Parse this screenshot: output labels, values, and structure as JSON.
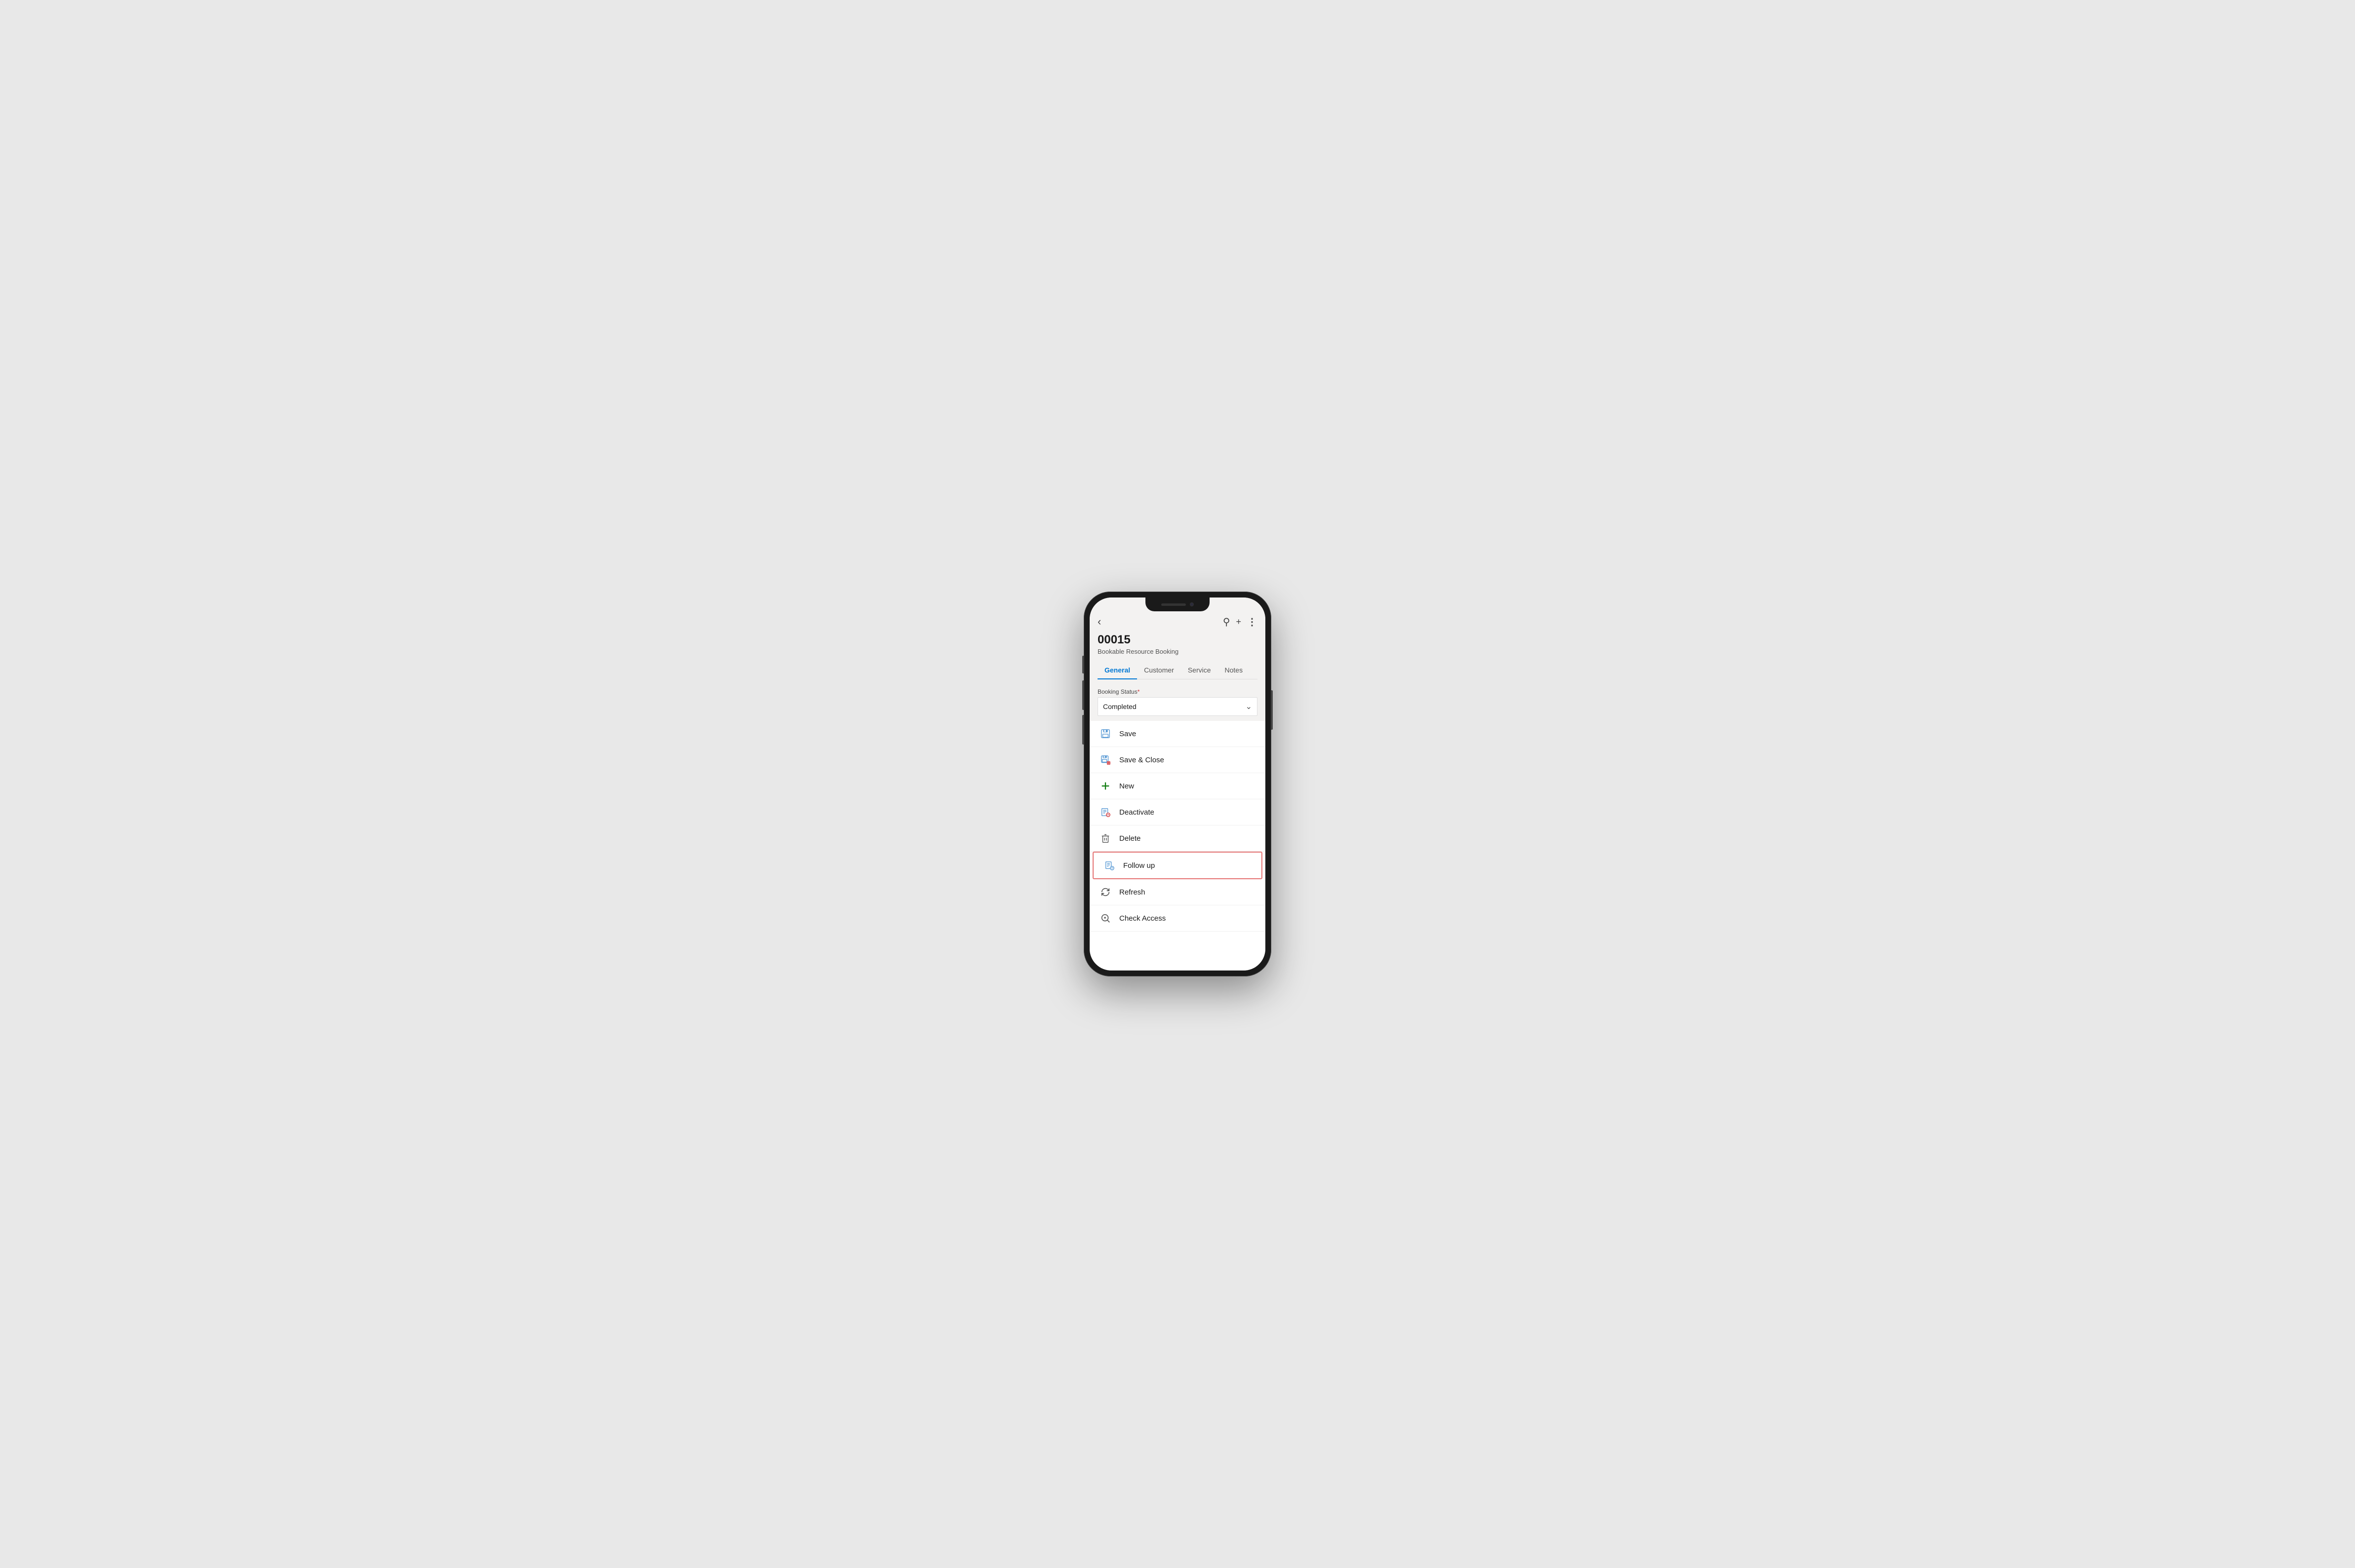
{
  "phone": {
    "notch": {
      "speaker_label": "speaker",
      "camera_label": "camera"
    }
  },
  "header": {
    "back_icon": "‹",
    "search_icon": "⌕",
    "add_icon": "+",
    "more_icon": "⋮",
    "record_id": "00015",
    "record_type": "Bookable Resource Booking"
  },
  "tabs": [
    {
      "id": "general",
      "label": "General",
      "active": true
    },
    {
      "id": "customer",
      "label": "Customer",
      "active": false
    },
    {
      "id": "service",
      "label": "Service",
      "active": false
    },
    {
      "id": "notes",
      "label": "Notes",
      "active": false
    }
  ],
  "booking_status": {
    "label": "Booking Status",
    "required": true,
    "value": "Completed"
  },
  "menu": {
    "items": [
      {
        "id": "save",
        "label": "Save",
        "icon": "save"
      },
      {
        "id": "save-close",
        "label": "Save & Close",
        "icon": "save-close"
      },
      {
        "id": "new",
        "label": "New",
        "icon": "new"
      },
      {
        "id": "deactivate",
        "label": "Deactivate",
        "icon": "deactivate"
      },
      {
        "id": "delete",
        "label": "Delete",
        "icon": "delete"
      },
      {
        "id": "follow-up",
        "label": "Follow up",
        "icon": "follow-up",
        "highlighted": true
      },
      {
        "id": "refresh",
        "label": "Refresh",
        "icon": "refresh"
      },
      {
        "id": "check-access",
        "label": "Check Access",
        "icon": "check-access"
      }
    ]
  }
}
